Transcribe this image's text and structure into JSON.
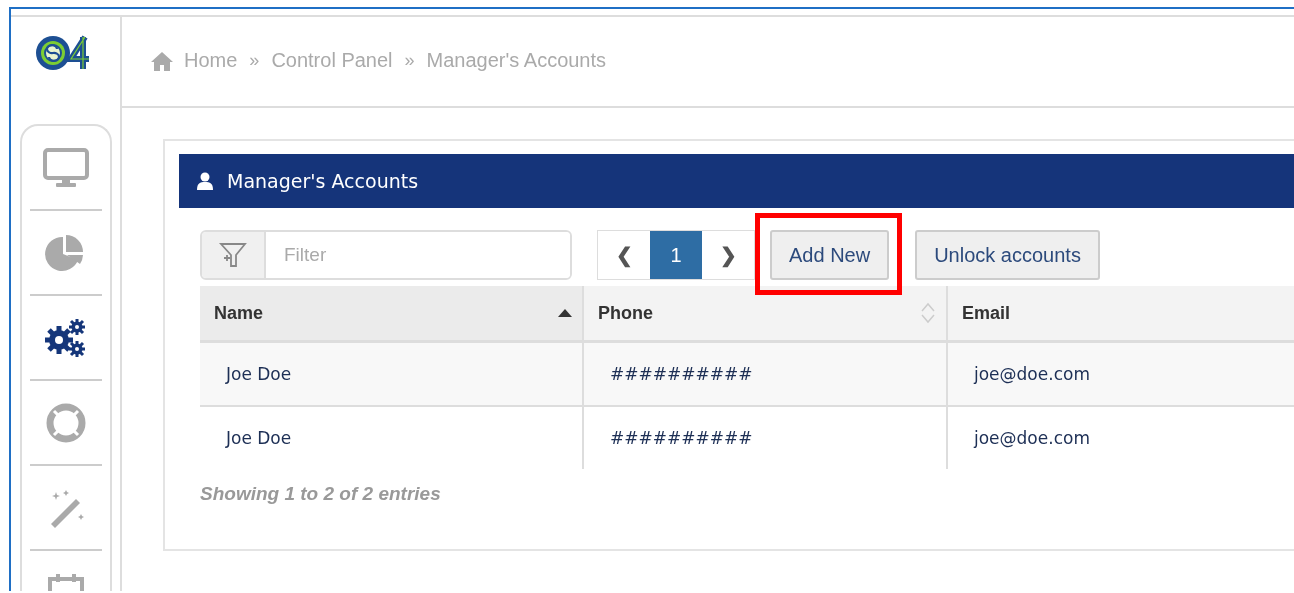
{
  "breadcrumb": [
    {
      "label": "Home"
    },
    {
      "label": "Control Panel"
    },
    {
      "label": "Manager's Accounts"
    }
  ],
  "breadcrumb_separator": "»",
  "sidebar": {
    "items": [
      {
        "selected": false
      },
      {
        "selected": false
      },
      {
        "selected": true
      },
      {
        "selected": false
      },
      {
        "selected": false
      },
      {
        "selected": false
      }
    ]
  },
  "panel": {
    "title": "Manager's Accounts"
  },
  "filter": {
    "placeholder": "Filter"
  },
  "pagination": [
    {
      "label": "❮",
      "selected": false
    },
    {
      "label": "1",
      "selected": true
    },
    {
      "label": "❯",
      "selected": false
    }
  ],
  "buttons": [
    {
      "label": "Add New",
      "highlighted": true
    },
    {
      "label": "Unlock accounts",
      "highlighted": false
    }
  ],
  "table": {
    "columns": [
      {
        "label": "Name",
        "sortable": true,
        "sorted_ascending": true
      },
      {
        "label": "Phone",
        "sortable": true,
        "sorted_ascending": false
      },
      {
        "label": "Email",
        "sortable": false
      }
    ],
    "rows": [
      [
        "Joe Doe",
        "##########",
        "joe@doe.com"
      ],
      [
        "Joe Doe",
        "##########",
        "joe@doe.com"
      ]
    ]
  },
  "footer": "Showing 1 to 2 of 2 entries"
}
